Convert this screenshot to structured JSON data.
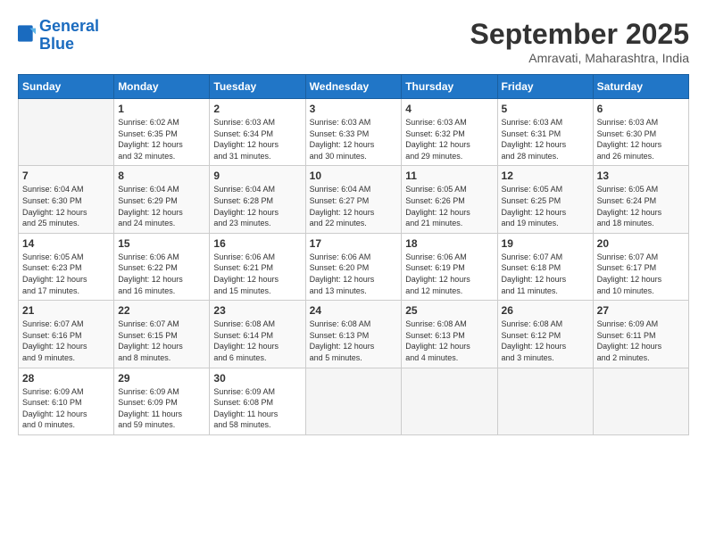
{
  "logo": {
    "line1": "General",
    "line2": "Blue"
  },
  "title": "September 2025",
  "subtitle": "Amravati, Maharashtra, India",
  "days_header": [
    "Sunday",
    "Monday",
    "Tuesday",
    "Wednesday",
    "Thursday",
    "Friday",
    "Saturday"
  ],
  "weeks": [
    [
      {
        "day": "",
        "info": ""
      },
      {
        "day": "1",
        "info": "Sunrise: 6:02 AM\nSunset: 6:35 PM\nDaylight: 12 hours\nand 32 minutes."
      },
      {
        "day": "2",
        "info": "Sunrise: 6:03 AM\nSunset: 6:34 PM\nDaylight: 12 hours\nand 31 minutes."
      },
      {
        "day": "3",
        "info": "Sunrise: 6:03 AM\nSunset: 6:33 PM\nDaylight: 12 hours\nand 30 minutes."
      },
      {
        "day": "4",
        "info": "Sunrise: 6:03 AM\nSunset: 6:32 PM\nDaylight: 12 hours\nand 29 minutes."
      },
      {
        "day": "5",
        "info": "Sunrise: 6:03 AM\nSunset: 6:31 PM\nDaylight: 12 hours\nand 28 minutes."
      },
      {
        "day": "6",
        "info": "Sunrise: 6:03 AM\nSunset: 6:30 PM\nDaylight: 12 hours\nand 26 minutes."
      }
    ],
    [
      {
        "day": "7",
        "info": "Sunrise: 6:04 AM\nSunset: 6:30 PM\nDaylight: 12 hours\nand 25 minutes."
      },
      {
        "day": "8",
        "info": "Sunrise: 6:04 AM\nSunset: 6:29 PM\nDaylight: 12 hours\nand 24 minutes."
      },
      {
        "day": "9",
        "info": "Sunrise: 6:04 AM\nSunset: 6:28 PM\nDaylight: 12 hours\nand 23 minutes."
      },
      {
        "day": "10",
        "info": "Sunrise: 6:04 AM\nSunset: 6:27 PM\nDaylight: 12 hours\nand 22 minutes."
      },
      {
        "day": "11",
        "info": "Sunrise: 6:05 AM\nSunset: 6:26 PM\nDaylight: 12 hours\nand 21 minutes."
      },
      {
        "day": "12",
        "info": "Sunrise: 6:05 AM\nSunset: 6:25 PM\nDaylight: 12 hours\nand 19 minutes."
      },
      {
        "day": "13",
        "info": "Sunrise: 6:05 AM\nSunset: 6:24 PM\nDaylight: 12 hours\nand 18 minutes."
      }
    ],
    [
      {
        "day": "14",
        "info": "Sunrise: 6:05 AM\nSunset: 6:23 PM\nDaylight: 12 hours\nand 17 minutes."
      },
      {
        "day": "15",
        "info": "Sunrise: 6:06 AM\nSunset: 6:22 PM\nDaylight: 12 hours\nand 16 minutes."
      },
      {
        "day": "16",
        "info": "Sunrise: 6:06 AM\nSunset: 6:21 PM\nDaylight: 12 hours\nand 15 minutes."
      },
      {
        "day": "17",
        "info": "Sunrise: 6:06 AM\nSunset: 6:20 PM\nDaylight: 12 hours\nand 13 minutes."
      },
      {
        "day": "18",
        "info": "Sunrise: 6:06 AM\nSunset: 6:19 PM\nDaylight: 12 hours\nand 12 minutes."
      },
      {
        "day": "19",
        "info": "Sunrise: 6:07 AM\nSunset: 6:18 PM\nDaylight: 12 hours\nand 11 minutes."
      },
      {
        "day": "20",
        "info": "Sunrise: 6:07 AM\nSunset: 6:17 PM\nDaylight: 12 hours\nand 10 minutes."
      }
    ],
    [
      {
        "day": "21",
        "info": "Sunrise: 6:07 AM\nSunset: 6:16 PM\nDaylight: 12 hours\nand 9 minutes."
      },
      {
        "day": "22",
        "info": "Sunrise: 6:07 AM\nSunset: 6:15 PM\nDaylight: 12 hours\nand 8 minutes."
      },
      {
        "day": "23",
        "info": "Sunrise: 6:08 AM\nSunset: 6:14 PM\nDaylight: 12 hours\nand 6 minutes."
      },
      {
        "day": "24",
        "info": "Sunrise: 6:08 AM\nSunset: 6:13 PM\nDaylight: 12 hours\nand 5 minutes."
      },
      {
        "day": "25",
        "info": "Sunrise: 6:08 AM\nSunset: 6:13 PM\nDaylight: 12 hours\nand 4 minutes."
      },
      {
        "day": "26",
        "info": "Sunrise: 6:08 AM\nSunset: 6:12 PM\nDaylight: 12 hours\nand 3 minutes."
      },
      {
        "day": "27",
        "info": "Sunrise: 6:09 AM\nSunset: 6:11 PM\nDaylight: 12 hours\nand 2 minutes."
      }
    ],
    [
      {
        "day": "28",
        "info": "Sunrise: 6:09 AM\nSunset: 6:10 PM\nDaylight: 12 hours\nand 0 minutes."
      },
      {
        "day": "29",
        "info": "Sunrise: 6:09 AM\nSunset: 6:09 PM\nDaylight: 11 hours\nand 59 minutes."
      },
      {
        "day": "30",
        "info": "Sunrise: 6:09 AM\nSunset: 6:08 PM\nDaylight: 11 hours\nand 58 minutes."
      },
      {
        "day": "",
        "info": ""
      },
      {
        "day": "",
        "info": ""
      },
      {
        "day": "",
        "info": ""
      },
      {
        "day": "",
        "info": ""
      }
    ]
  ]
}
